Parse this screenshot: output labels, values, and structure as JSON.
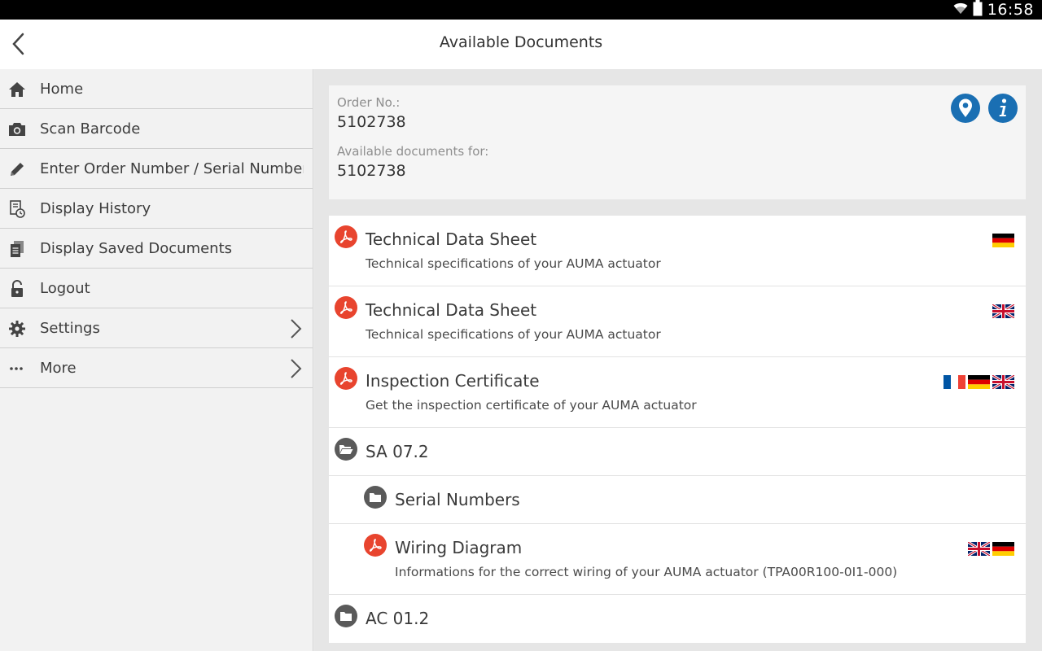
{
  "status_bar": {
    "time": "16:58"
  },
  "appbar": {
    "title": "Available Documents"
  },
  "sidebar": {
    "items": [
      {
        "label": "Home",
        "icon": "home-icon"
      },
      {
        "label": "Scan Barcode",
        "icon": "camera-icon"
      },
      {
        "label": "Enter Order Number / Serial Number...",
        "icon": "pencil-icon"
      },
      {
        "label": "Display History",
        "icon": "history-icon"
      },
      {
        "label": "Display Saved Documents",
        "icon": "documents-icon"
      },
      {
        "label": "Logout",
        "icon": "unlock-icon"
      },
      {
        "label": "Settings",
        "icon": "gear-icon",
        "chevron": true
      },
      {
        "label": "More",
        "icon": "more-icon",
        "chevron": true
      }
    ]
  },
  "order": {
    "order_no_label": "Order No.:",
    "order_no": "5102738",
    "available_for_label": "Available documents for:",
    "available_for": "5102738"
  },
  "documents": [
    {
      "type": "pdf",
      "title": "Technical Data Sheet",
      "subtitle": "Technical specifications of your AUMA actuator",
      "flags": [
        "de"
      ]
    },
    {
      "type": "pdf",
      "title": "Technical Data Sheet",
      "subtitle": "Technical specifications of your AUMA actuator",
      "flags": [
        "gb"
      ]
    },
    {
      "type": "pdf",
      "title": "Inspection Certificate",
      "subtitle": "Get the inspection certificate of your AUMA actuator",
      "flags": [
        "fr",
        "de",
        "gb"
      ]
    },
    {
      "type": "folder-open",
      "title": "SA 07.2"
    },
    {
      "type": "folder",
      "title": "Serial Numbers",
      "indent": true
    },
    {
      "type": "pdf",
      "title": "Wiring Diagram",
      "subtitle": "Informations for the correct wiring of your AUMA actuator (TPA00R100-0I1-000)",
      "flags": [
        "gb",
        "de"
      ],
      "indent": true
    },
    {
      "type": "folder",
      "title": "AC 01.2"
    }
  ],
  "colors": {
    "accent_blue": "#1a6fb3",
    "pdf_red": "#e8442e",
    "folder_gray": "#5a5a5a"
  }
}
